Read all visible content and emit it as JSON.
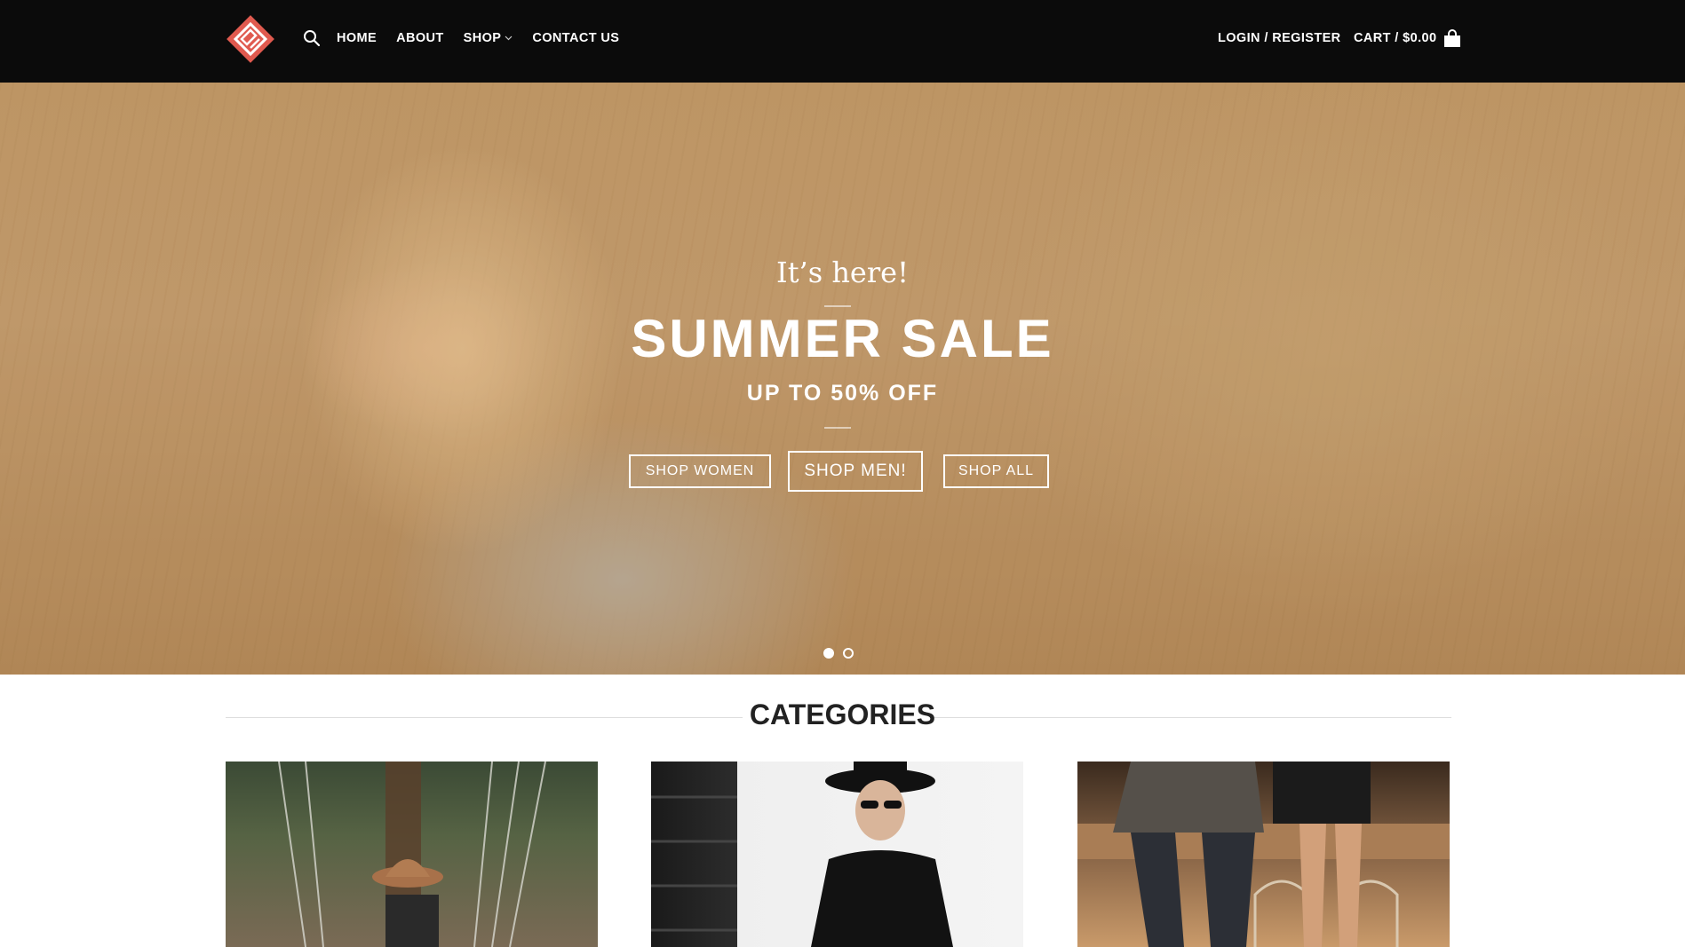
{
  "header": {
    "logo": "brand-logo",
    "nav": [
      {
        "label": "HOME"
      },
      {
        "label": "ABOUT"
      },
      {
        "label": "SHOP"
      },
      {
        "label": "CONTACT US"
      }
    ],
    "login_label": "LOGIN / REGISTER",
    "cart_label": "CART / $0.00"
  },
  "hero": {
    "tagline": "It’s here!",
    "title": "SUMMER SALE",
    "subtitle": "UP TO 50% OFF",
    "buttons": {
      "women": "SHOP WOMEN",
      "men": "SHOP MEN!",
      "all": "SHOP ALL"
    },
    "slides": {
      "current": 1,
      "total": 2
    }
  },
  "categories": {
    "heading": "CATEGORIES"
  },
  "colors": {
    "header_bg": "#0b0b0b",
    "logo_accent": "#e05a4f",
    "text_light": "#ffffff"
  }
}
